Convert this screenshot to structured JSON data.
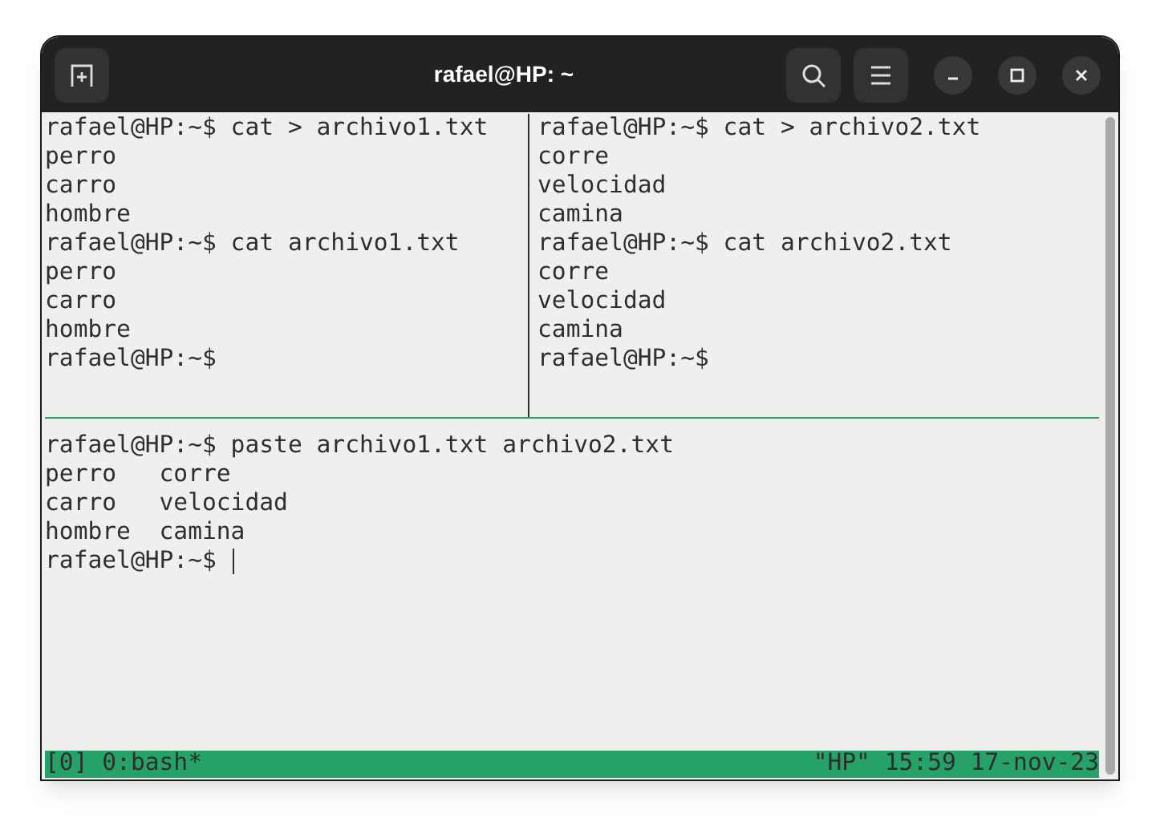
{
  "window": {
    "title": "rafael@HP: ~"
  },
  "panes": [
    {
      "lines": [
        "rafael@HP:~$ cat > archivo1.txt",
        "perro",
        "carro",
        "hombre",
        "rafael@HP:~$ cat archivo1.txt",
        "perro",
        "carro",
        "hombre",
        "rafael@HP:~$"
      ]
    },
    {
      "lines": [
        "rafael@HP:~$ cat > archivo2.txt",
        "corre",
        "velocidad",
        "camina",
        "rafael@HP:~$ cat archivo2.txt",
        "corre",
        "velocidad",
        "camina",
        "rafael@HP:~$"
      ]
    },
    {
      "lines": [
        "rafael@HP:~$ paste archivo1.txt archivo2.txt",
        "perro   corre",
        "carro   velocidad",
        "hombre  camina",
        "rafael@HP:~$"
      ],
      "cursor": true
    }
  ],
  "status_bar": {
    "left": "[0] 0:bash*",
    "right": "\"HP\" 15:59 17-nov-23"
  }
}
